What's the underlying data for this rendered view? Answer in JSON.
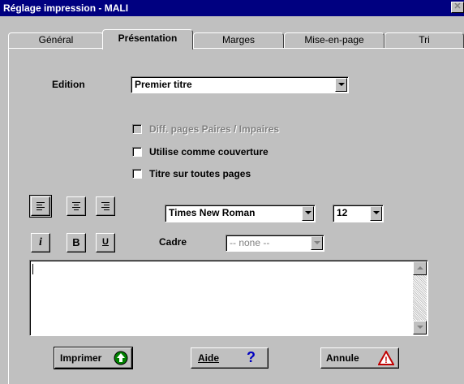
{
  "window": {
    "title": "Réglage impression - MALI",
    "close_glyph": "✕"
  },
  "tabs": [
    {
      "label": "Général"
    },
    {
      "label": "Présentation"
    },
    {
      "label": "Marges"
    },
    {
      "label": "Mise-en-page"
    },
    {
      "label": "Tri"
    }
  ],
  "active_tab": "Présentation",
  "edition": {
    "label": "Edition",
    "value": "Premier titre"
  },
  "checkboxes": [
    {
      "label": "Diff. pages Paires / Impaires",
      "checked": false,
      "disabled": true
    },
    {
      "label": "Utilise comme couverture",
      "checked": false,
      "disabled": false
    },
    {
      "label": "Titre sur toutes pages",
      "checked": false,
      "disabled": false
    }
  ],
  "font": {
    "family": "Times New Roman",
    "size": "12"
  },
  "style_buttons": {
    "italic": "i",
    "bold": "B",
    "underline": "U"
  },
  "cadre": {
    "label": "Cadre",
    "value": "-- none --"
  },
  "text_content": "",
  "buttons": {
    "print": "Imprimer",
    "help": "Aide",
    "help_glyph": "?",
    "cancel": "Annule",
    "cancel_glyph": "!"
  },
  "colors": {
    "titlebar": "#000080",
    "face": "#c0c0c0",
    "print_icon": "#008000",
    "cancel_icon": "#c00000",
    "help_icon": "#0000c0"
  },
  "icons": [
    "close-icon",
    "align-left-icon",
    "align-center-icon",
    "align-right-icon",
    "italic-icon",
    "bold-icon",
    "underline-icon",
    "print-arrow-icon",
    "help-question-icon",
    "warning-triangle-icon"
  ]
}
